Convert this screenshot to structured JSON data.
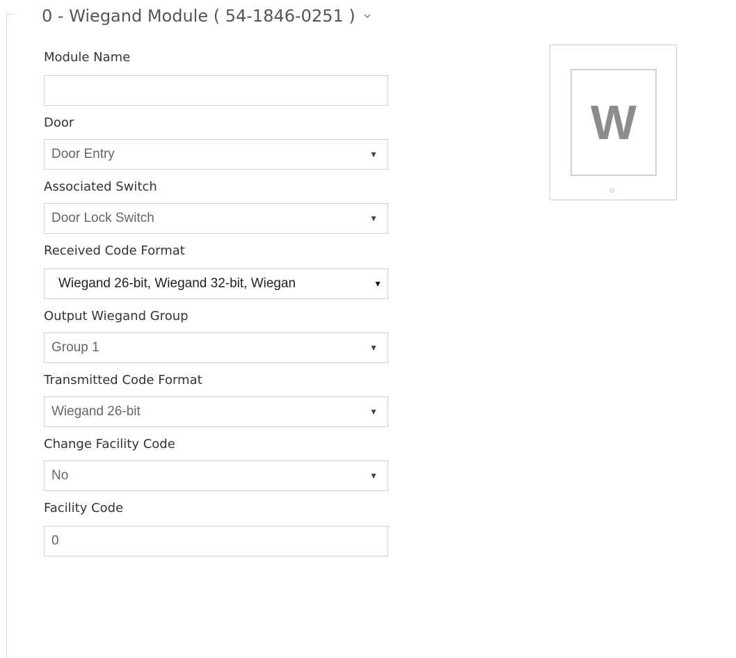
{
  "header": {
    "title": "0 - Wiegand Module ( 54-1846-0251 )",
    "chevron_icon": "chevron-down-icon"
  },
  "fields": {
    "module_name": {
      "label": "Module Name",
      "value": ""
    },
    "door": {
      "label": "Door",
      "value": "Door Entry"
    },
    "associated_switch": {
      "label": "Associated Switch",
      "value": "Door Lock Switch"
    },
    "received_code_format": {
      "label": "Received Code Format",
      "value": "Wiegand 26-bit, Wiegand 32-bit, Wiegan"
    },
    "output_wiegand_group": {
      "label": "Output Wiegand Group",
      "value": "Group 1"
    },
    "transmitted_code_format": {
      "label": "Transmitted Code Format",
      "value": "Wiegand 26-bit"
    },
    "change_facility_code": {
      "label": "Change Facility Code",
      "value": "No"
    },
    "facility_code": {
      "label": "Facility Code",
      "value": "0"
    }
  },
  "dropdown_caret": "▼",
  "module_image": {
    "letter": "W",
    "icon": "wiegand-module-icon"
  }
}
